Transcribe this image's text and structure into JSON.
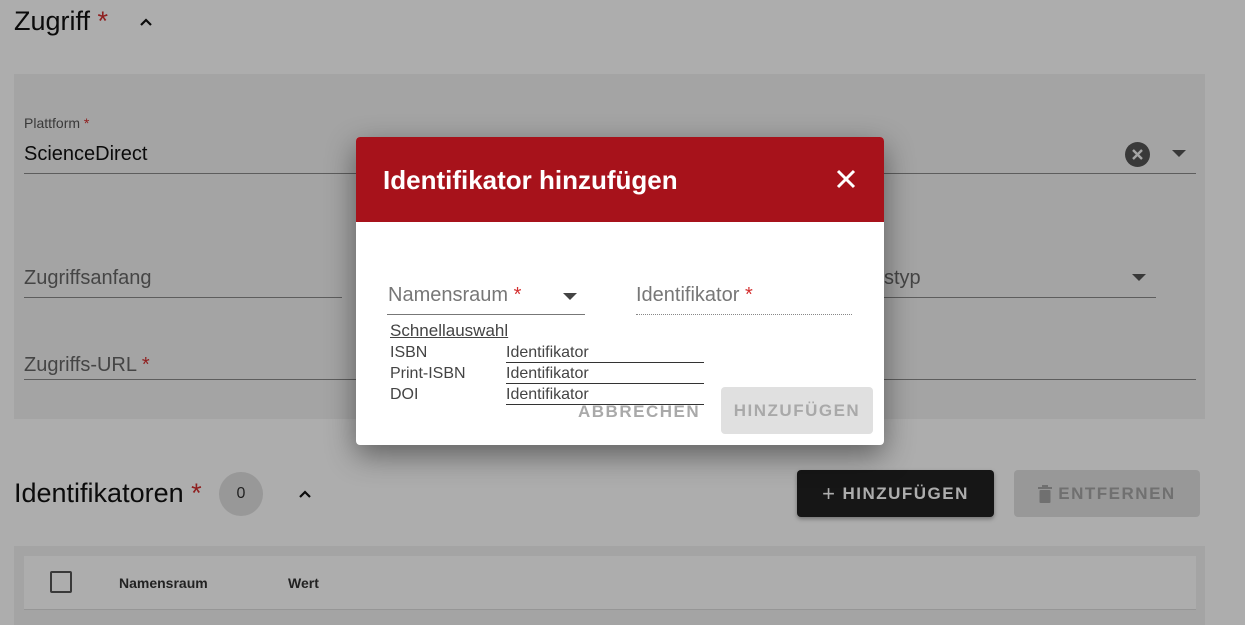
{
  "access_section": {
    "title": "Zugriff",
    "required_mark": "*"
  },
  "platform": {
    "label": "Plattform",
    "required_mark": "*",
    "value": "ScienceDirect"
  },
  "access_start": {
    "placeholder": "Zugriffsanfang"
  },
  "access_type": {
    "placeholder_partial": "styp"
  },
  "access_url": {
    "placeholder": "Zugriffs-URL",
    "required_mark": "*"
  },
  "identifiers_section": {
    "title": "Identifikatoren",
    "required_mark": "*",
    "count": "0",
    "add_label": "HINZUFÜGEN",
    "remove_label": "ENTFERNEN"
  },
  "table": {
    "columns": [
      "Namensraum",
      "Wert"
    ]
  },
  "dialog": {
    "title": "Identifikator hinzufügen",
    "namespace_field": {
      "placeholder": "Namensraum",
      "required_mark": "*"
    },
    "identifier_field": {
      "placeholder": "Identifikator",
      "required_mark": "*"
    },
    "quick_select": {
      "label": "Schnellauswahl",
      "items": [
        {
          "namespace": "ISBN",
          "input_placeholder": "Identifikator"
        },
        {
          "namespace": "Print-ISBN",
          "input_placeholder": "Identifikator"
        },
        {
          "namespace": "DOI",
          "input_placeholder": "Identifikator"
        }
      ]
    },
    "cancel_label": "ABBRECHEN",
    "submit_label": "HINZUFÜGEN"
  },
  "colors": {
    "dialog_header": "#a7121b",
    "required": "#d32f2f",
    "primary_button": "#212121"
  }
}
